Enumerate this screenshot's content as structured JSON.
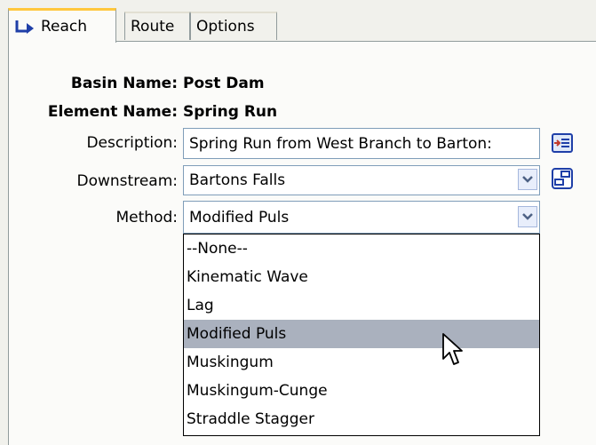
{
  "tabs": [
    {
      "label": "Reach",
      "active": true,
      "icon": "reach-icon"
    },
    {
      "label": "Route",
      "active": false
    },
    {
      "label": "Options",
      "active": false
    }
  ],
  "form": {
    "basin_name_label": "Basin Name:",
    "basin_name_value": "Post Dam",
    "element_name_label": "Element Name:",
    "element_name_value": "Spring Run",
    "description_label": "Description:",
    "description_value": "Spring Run from West Branch to Barton:",
    "downstream_label": "Downstream:",
    "downstream_value": "Bartons Falls",
    "method_label": "Method:",
    "method_value": "Modified Puls"
  },
  "method_options": [
    "--None--",
    "Kinematic Wave",
    "Lag",
    "Modified Puls",
    "Muskingum",
    "Muskingum-Cunge",
    "Straddle Stagger"
  ],
  "highlighted_option": "Modified Puls",
  "colors": {
    "highlight": "#aab1be",
    "tab_accent": "#ffc73c",
    "field_border": "#7f9db9"
  }
}
